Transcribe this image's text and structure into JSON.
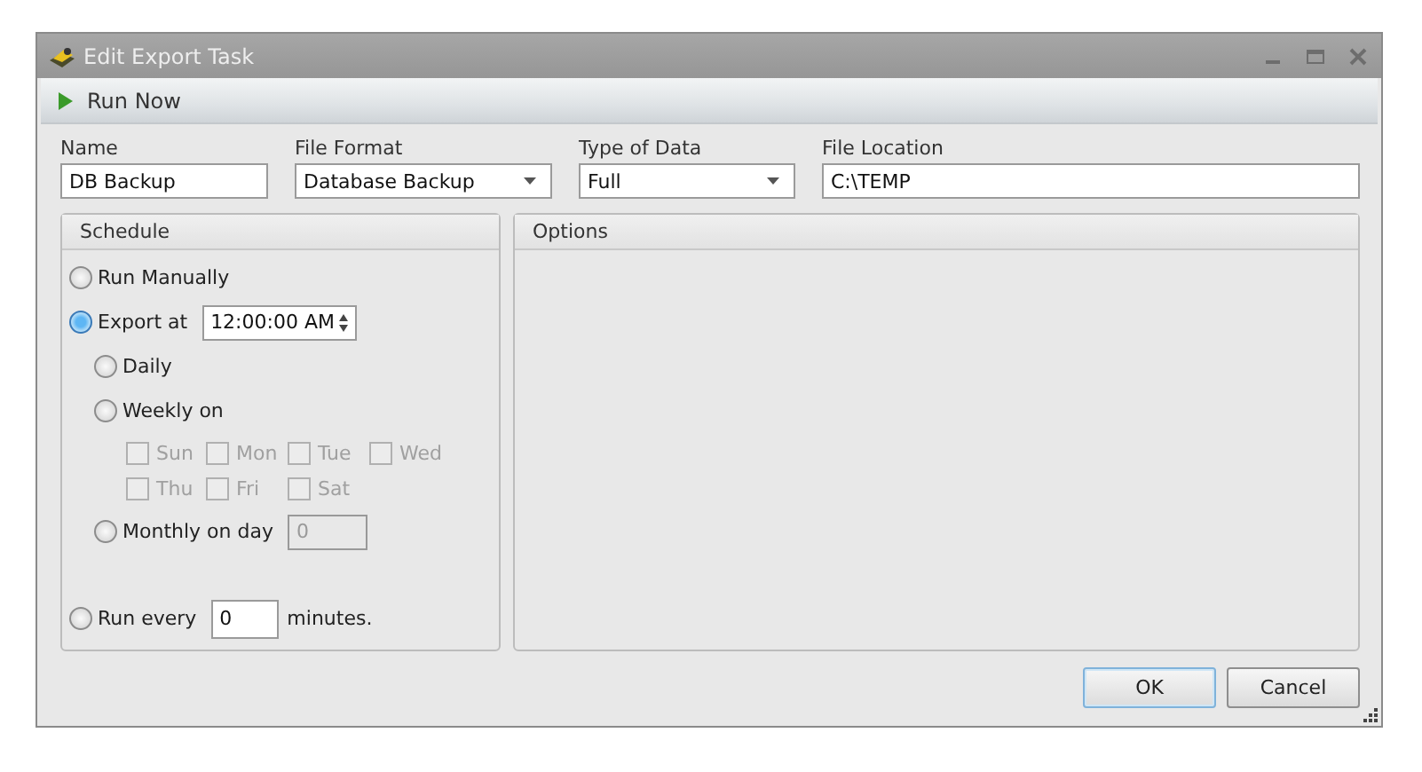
{
  "window": {
    "title": "Edit Export Task"
  },
  "toolbar": {
    "items": [
      {
        "label": "Run Now"
      }
    ]
  },
  "fields": [
    {
      "kind": "text",
      "label": "Name",
      "value": "DB Backup"
    },
    {
      "kind": "dropdown",
      "label": "File Format",
      "value": "Database Backup"
    },
    {
      "kind": "dropdown",
      "label": "Type of Data",
      "value": "Full"
    },
    {
      "kind": "text",
      "label": "File Location",
      "value": "C:\\TEMP"
    }
  ],
  "schedule": {
    "title": "Schedule",
    "items": [
      {
        "kind": "radio",
        "label": "Run Manually",
        "selected": false
      },
      {
        "kind": "time",
        "label": "Export at",
        "selected": true,
        "value": "12:00:00 AM",
        "children": [
          {
            "kind": "radio",
            "label": "Daily",
            "selected": false
          },
          {
            "kind": "days",
            "label": "Weekly on",
            "selected": false,
            "days": [
              {
                "label": "Sun",
                "checked": false,
                "disabled": true
              },
              {
                "label": "Mon",
                "checked": false,
                "disabled": true
              },
              {
                "label": "Tue",
                "checked": false,
                "disabled": true
              },
              {
                "label": "Wed",
                "checked": false,
                "disabled": true
              },
              {
                "label": "Thu",
                "checked": false,
                "disabled": true
              },
              {
                "label": "Fri",
                "checked": false,
                "disabled": true
              },
              {
                "label": "Sat",
                "checked": false,
                "disabled": true
              }
            ]
          },
          {
            "kind": "day",
            "label": "Monthly on day",
            "selected": false,
            "value": "0",
            "disabled": true
          }
        ]
      },
      {
        "kind": "every",
        "label": "Run every",
        "selected": false,
        "value": "0",
        "suffix": "minutes."
      }
    ]
  },
  "options": {
    "title": "Options"
  },
  "buttons": [
    {
      "label": "OK",
      "default": true
    },
    {
      "label": "Cancel",
      "default": false
    }
  ]
}
